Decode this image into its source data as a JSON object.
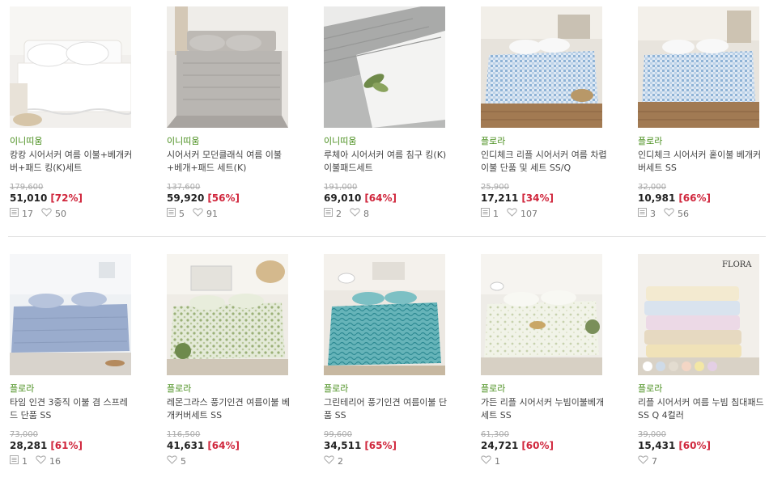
{
  "colors": {
    "brand": "#4a8f1e",
    "discount": "#d0263c",
    "divider": "#e3e3e3"
  },
  "rows": [
    [
      {
        "brand": "이니띠움",
        "name": "캉캉 시어서커 여름 이불+베개커버+패드 킹(K)세트",
        "original_price": "179,600",
        "price": "51,010",
        "discount": "[72%]",
        "reviews": "17",
        "likes": "50",
        "icons": [
          "review-icon",
          "heart-icon"
        ]
      },
      {
        "brand": "이니띠움",
        "name": "시어서커 모던클래식 여름 이불+베개+패드 세트(K)",
        "original_price": "137,600",
        "price": "59,920",
        "discount": "[56%]",
        "reviews": "5",
        "likes": "91",
        "icons": [
          "review-icon",
          "heart-icon"
        ]
      },
      {
        "brand": "이니띠움",
        "name": "루체아 시어서커 여름 침구 킹(K)이불패드세트",
        "original_price": "191,000",
        "price": "69,010",
        "discount": "[64%]",
        "reviews": "2",
        "likes": "8",
        "icons": [
          "review-icon",
          "heart-icon"
        ]
      },
      {
        "brand": "플로라",
        "name": "인디체크 리플 시어서커 여름 차렵이불 단품 및 세트 SS/Q",
        "original_price": "25,900",
        "price": "17,211",
        "discount": "[34%]",
        "reviews": "1",
        "likes": "107",
        "icons": [
          "review-icon",
          "heart-icon"
        ]
      },
      {
        "brand": "플로라",
        "name": "인디체크 시어서커 홑이불 베개커버세트 SS",
        "original_price": "32,000",
        "price": "10,981",
        "discount": "[66%]",
        "reviews": "3",
        "likes": "56",
        "icons": [
          "review-icon",
          "heart-icon"
        ]
      }
    ],
    [
      {
        "brand": "플로라",
        "name": "타임 인견 3중직 이불 겸 스프레드 단품 SS",
        "original_price": "73,000",
        "price": "28,281",
        "discount": "[61%]",
        "reviews": "1",
        "likes": "16",
        "icons": [
          "review-icon",
          "heart-icon"
        ]
      },
      {
        "brand": "플로라",
        "name": "레몬그라스 풍기인견 여름이불 베개커버세트 SS",
        "original_price": "116,500",
        "price": "41,631",
        "discount": "[64%]",
        "reviews": "",
        "likes": "5",
        "icons": [
          "heart-icon"
        ]
      },
      {
        "brand": "플로라",
        "name": "그린테리어 풍기인견 여름이불 단품 SS",
        "original_price": "99,600",
        "price": "34,511",
        "discount": "[65%]",
        "reviews": "",
        "likes": "2",
        "icons": [
          "heart-icon"
        ]
      },
      {
        "brand": "플로라",
        "name": "가든 리플 시어서커 누빔이불베개세트 SS",
        "original_price": "61,300",
        "price": "24,721",
        "discount": "[60%]",
        "reviews": "",
        "likes": "1",
        "icons": [
          "heart-icon"
        ]
      },
      {
        "brand": "플로라",
        "name": "리플 시어서커 여름 누빔 침대패드 SS Q 4컬러",
        "original_price": "39,000",
        "price": "15,431",
        "discount": "[60%]",
        "reviews": "",
        "likes": "7",
        "icons": [
          "heart-icon"
        ],
        "image_label": "FLORA"
      }
    ]
  ]
}
